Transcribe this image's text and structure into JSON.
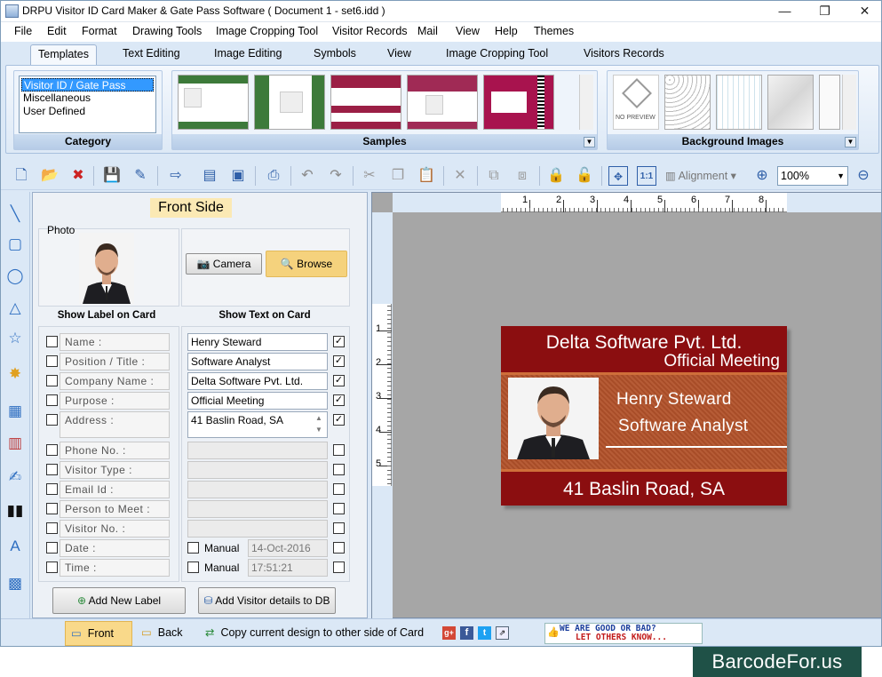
{
  "window": {
    "title": "DRPU Visitor ID Card Maker & Gate Pass Software ( Document 1 - set6.idd )",
    "minimize_glyph": "—",
    "restore_glyph": "❐",
    "close_glyph": "✕"
  },
  "menu": [
    "File",
    "Edit",
    "Format",
    "Drawing Tools",
    "Image Cropping Tool",
    "Visitor Records",
    "Mail",
    "View",
    "Help",
    "Themes"
  ],
  "ribbon_tabs": [
    "Templates",
    "Text Editing",
    "Image Editing",
    "Symbols",
    "View",
    "Image Cropping Tool",
    "Visitors Records"
  ],
  "ribbon": {
    "category": {
      "caption": "Category",
      "items": [
        "Visitor ID / Gate Pass",
        "Miscellaneous",
        "User Defined"
      ]
    },
    "samples": {
      "caption": "Samples",
      "colors": [
        "#3d7a3a",
        "#3d7a3a",
        "#9b1f45",
        "#a02a55",
        "#a8134e"
      ]
    },
    "background_images": {
      "caption": "Background Images",
      "no_preview": "NO PREVIEW"
    }
  },
  "toolbar": {
    "alignment_label": "Alignment",
    "zoom_value": "100%"
  },
  "panel": {
    "title": "Front Side",
    "photo_label": "Photo",
    "camera_button": "Camera",
    "browse_button": "Browse",
    "show_label_header": "Show Label on Card",
    "show_text_header": "Show Text on Card",
    "rows": [
      {
        "label": "Name :",
        "value": "Henry Steward",
        "label_checked": false,
        "text_checked": true
      },
      {
        "label": "Position / Title :",
        "value": "Software Analyst",
        "label_checked": false,
        "text_checked": true
      },
      {
        "label": "Company Name :",
        "value": "Delta Software Pvt. Ltd.",
        "label_checked": false,
        "text_checked": true
      },
      {
        "label": "Purpose :",
        "value": "Official Meeting",
        "label_checked": false,
        "text_checked": true
      },
      {
        "label": "Address :",
        "value": "41 Baslin Road, SA",
        "label_checked": false,
        "text_checked": true
      },
      {
        "label": "Phone No. :",
        "value": "",
        "label_checked": false,
        "text_checked": false
      },
      {
        "label": "Visitor Type :",
        "value": "",
        "label_checked": false,
        "text_checked": false
      },
      {
        "label": "Email Id :",
        "value": "",
        "label_checked": false,
        "text_checked": false
      },
      {
        "label": "Person to Meet :",
        "value": "",
        "label_checked": false,
        "text_checked": false
      },
      {
        "label": "Visitor No. :",
        "value": "",
        "label_checked": false,
        "text_checked": false
      },
      {
        "label": "Date :",
        "manual": "Manual",
        "value": "14-Oct-2016",
        "label_checked": false,
        "text_checked": false
      },
      {
        "label": "Time :",
        "manual": "Manual",
        "value": "17:51:21",
        "label_checked": false,
        "text_checked": false
      }
    ],
    "add_label_button": "Add New Label",
    "add_db_button": "Add Visitor details to DB"
  },
  "ruler": {
    "top": [
      "1",
      "2",
      "3",
      "4",
      "5",
      "6",
      "7",
      "8"
    ],
    "left": [
      "1",
      "2",
      "3",
      "4",
      "5"
    ]
  },
  "card": {
    "company": "Delta Software Pvt. Ltd.",
    "purpose": "Official Meeting",
    "name": "Henry Steward",
    "title": "Software Analyst",
    "address": "41 Baslin Road, SA",
    "colors": {
      "header": "#8b0e10",
      "body": "#b2522a",
      "footer": "#8b0e10"
    }
  },
  "statusbar": {
    "front": "Front",
    "back": "Back",
    "copy": "Copy current design to other side of Card",
    "rate_line1": "WE ARE GOOD OR BAD?",
    "rate_line2": "LET OTHERS KNOW..."
  },
  "watermark": "BarcodeFor.us"
}
